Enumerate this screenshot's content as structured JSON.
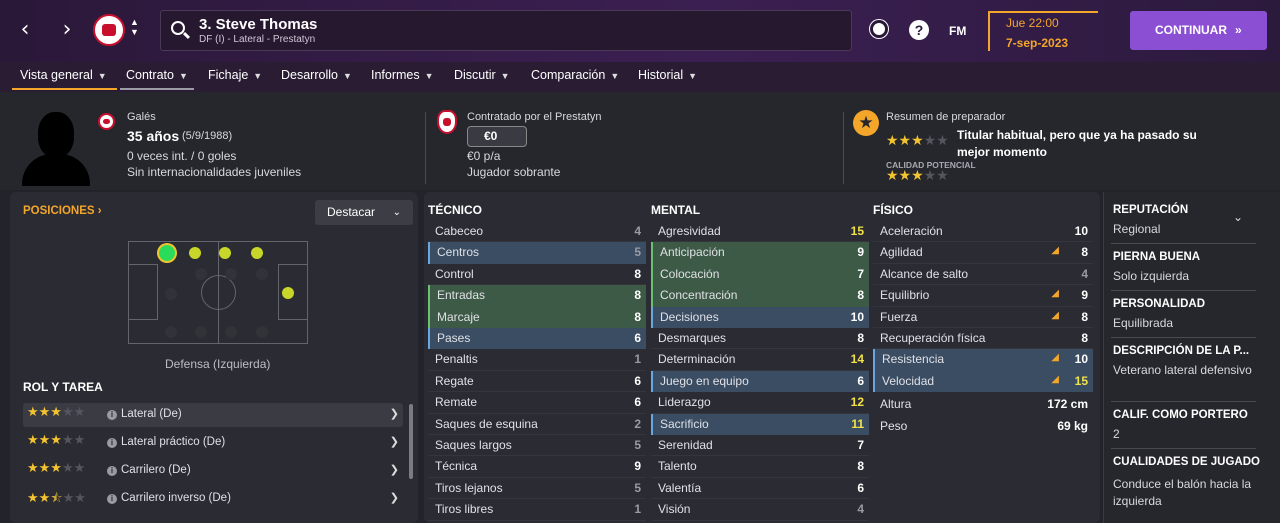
{
  "topbar": {
    "player_title": "3. Steve Thomas",
    "player_sub": "DF (I) - Lateral - Prestatyn",
    "fm_label": "FM",
    "date_time": "Jue 22:00",
    "date": "7-sep-2023",
    "continue_label": "CONTINUAR",
    "icons": [
      "back-arrow-icon",
      "forward-arrow-icon",
      "club-crest-icon",
      "search-icon",
      "ball-icon",
      "help-icon"
    ]
  },
  "tabs": [
    {
      "label": "Vista general"
    },
    {
      "label": "Contrato"
    },
    {
      "label": "Fichaje"
    },
    {
      "label": "Desarrollo"
    },
    {
      "label": "Informes"
    },
    {
      "label": "Discutir"
    },
    {
      "label": "Comparación"
    },
    {
      "label": "Historial"
    }
  ],
  "header": {
    "nationality": "Galés",
    "age": "35 años",
    "dob": "(5/9/1988)",
    "caps": "0 veces int. / 0 goles",
    "youth": "Sin internacionalidades juveniles",
    "contract_by": "Contratado por el Prestatyn",
    "fee": "€0",
    "wage": "€0 p/a",
    "squad_status": "Jugador sobrante",
    "coach_title": "Resumen de preparador",
    "coach_text": "Titular habitual, pero que ya ha pasado su mejor momento",
    "current_ability_stars": 3,
    "potential_label": "CALIDAD POTENCIAL",
    "potential_stars": 3
  },
  "positions": {
    "title": "POSICIONES",
    "highlight_label": "Destacar",
    "position_label": "Defensa (Izquierda)"
  },
  "roles": {
    "title": "ROL Y TAREA",
    "items": [
      {
        "name": "Lateral (De)",
        "stars": 3
      },
      {
        "name": "Lateral práctico (De)",
        "stars": 3
      },
      {
        "name": "Carrilero (De)",
        "stars": 3
      },
      {
        "name": "Carrilero inverso (De)",
        "stars": 2.5
      }
    ]
  },
  "tecnico": {
    "title": "TÉCNICO",
    "items": [
      {
        "name": "Cabeceo",
        "value": "4"
      },
      {
        "name": "Centros",
        "value": "5"
      },
      {
        "name": "Control",
        "value": "8"
      },
      {
        "name": "Entradas",
        "value": "8"
      },
      {
        "name": "Marcaje",
        "value": "8"
      },
      {
        "name": "Pases",
        "value": "6"
      },
      {
        "name": "Penaltis",
        "value": "1"
      },
      {
        "name": "Regate",
        "value": "6"
      },
      {
        "name": "Remate",
        "value": "6"
      },
      {
        "name": "Saques de esquina",
        "value": "2"
      },
      {
        "name": "Saques largos",
        "value": "5"
      },
      {
        "name": "Técnica",
        "value": "9"
      },
      {
        "name": "Tiros lejanos",
        "value": "5"
      },
      {
        "name": "Tiros libres",
        "value": "1"
      }
    ]
  },
  "mental": {
    "title": "MENTAL",
    "items": [
      {
        "name": "Agresividad",
        "value": "15"
      },
      {
        "name": "Anticipación",
        "value": "9"
      },
      {
        "name": "Colocación",
        "value": "7"
      },
      {
        "name": "Concentración",
        "value": "8"
      },
      {
        "name": "Decisiones",
        "value": "10"
      },
      {
        "name": "Desmarques",
        "value": "8"
      },
      {
        "name": "Determinación",
        "value": "14"
      },
      {
        "name": "Juego en equipo",
        "value": "6"
      },
      {
        "name": "Liderazgo",
        "value": "12"
      },
      {
        "name": "Sacrificio",
        "value": "11"
      },
      {
        "name": "Serenidad",
        "value": "7"
      },
      {
        "name": "Talento",
        "value": "8"
      },
      {
        "name": "Valentía",
        "value": "6"
      },
      {
        "name": "Visión",
        "value": "4"
      }
    ]
  },
  "fisico": {
    "title": "FÍSICO",
    "items": [
      {
        "name": "Aceleración",
        "value": "10"
      },
      {
        "name": "Agilidad",
        "value": "8"
      },
      {
        "name": "Alcance de salto",
        "value": "4"
      },
      {
        "name": "Equilibrio",
        "value": "9"
      },
      {
        "name": "Fuerza",
        "value": "8"
      },
      {
        "name": "Recuperación física",
        "value": "8"
      },
      {
        "name": "Resistencia",
        "value": "10"
      },
      {
        "name": "Velocidad",
        "value": "15"
      },
      {
        "name": "Altura",
        "value": "172 cm"
      },
      {
        "name": "Peso",
        "value": "69 kg"
      }
    ]
  },
  "right_panel": {
    "reputation_label": "REPUTACIÓN",
    "reputation": "Regional",
    "foot_label": "PIERNA BUENA",
    "foot": "Solo izquierda",
    "personality_label": "PERSONALIDAD",
    "personality": "Equilibrada",
    "desc_label": "DESCRIPCIÓN DE LA P...",
    "desc": "Veterano lateral defensivo",
    "gk_label": "CALIF. COMO PORTERO",
    "gk": "2",
    "traits_label": "CUALIDADES DE JUGADO",
    "traits": "Conduce el balón hacia la izquierda"
  },
  "colors": {
    "accent": "#f4a62a",
    "continue": "#8b4fd4",
    "green_row": "#3c5a45",
    "blue_row": "#3a4d62",
    "yellow_value": "#f2e24a",
    "dim_value": "#9a9aa2"
  }
}
